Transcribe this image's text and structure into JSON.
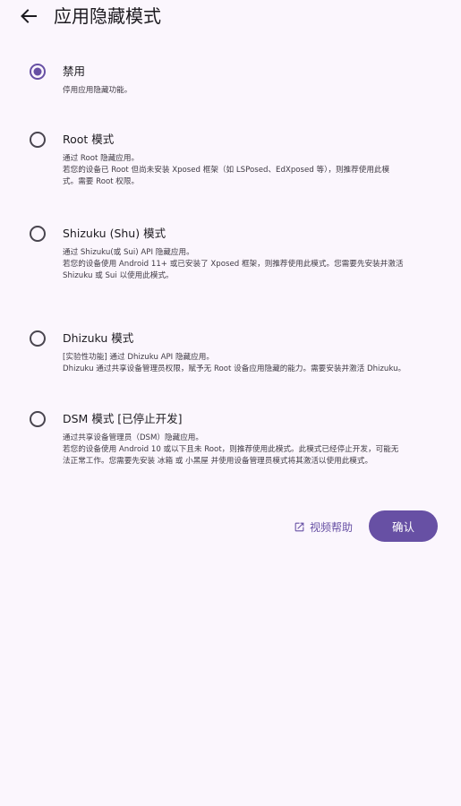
{
  "header": {
    "title": "应用隐藏模式",
    "back_icon": "arrow-left-icon"
  },
  "options": [
    {
      "title": "禁用",
      "desc": [
        "停用应用隐藏功能。"
      ],
      "selected": true
    },
    {
      "title": "Root 模式",
      "desc": [
        "通过 Root 隐藏应用。",
        "若您的设备已 Root 但尚未安装 Xposed 框架（如 LSPosed、EdXposed 等），则推荐使用此模",
        "式。需要 Root 权限。"
      ],
      "selected": false
    },
    {
      "title": "Shizuku (Shu) 模式",
      "desc": [
        "通过 Shizuku(或 Sui) API 隐藏应用。",
        "若您的设备使用 Android 11+ 或已安装了 Xposed 框架，则推荐使用此模式。您需要先安装并激活",
        "Shizuku 或 Sui 以使用此模式。"
      ],
      "selected": false
    },
    {
      "title": "Dhizuku 模式",
      "desc": [
        "[实验性功能] 通过 Dhizuku API 隐藏应用。",
        "Dhizuku 通过共享设备管理员权限，赋予无 Root 设备应用隐藏的能力。需要安装并激活 Dhizuku。"
      ],
      "selected": false
    },
    {
      "title": "DSM 模式 [已停止开发]",
      "desc": [
        "通过共享设备管理员（DSM）隐藏应用。",
        "若您的设备使用 Android 10 或以下且未 Root，则推荐使用此模式。此模式已经停止开发，可能无",
        "法正常工作。您需要先安装 冰箱 或 小黑屋 并使用设备管理员模式将其激活以使用此模式。"
      ],
      "selected": false
    }
  ],
  "actions": {
    "help_label": "视频帮助",
    "help_icon": "open-external-icon",
    "confirm_label": "确认"
  },
  "colors": {
    "accent": "#6750a4",
    "background": "#fbf6fd",
    "radio_unselected": "#49454f"
  }
}
